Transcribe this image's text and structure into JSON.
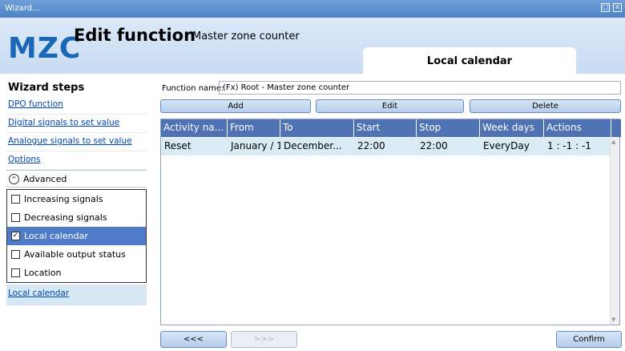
{
  "window": {
    "title": "Wizard...",
    "controls": [
      "□",
      "x"
    ]
  },
  "header": {
    "logo": "MZC",
    "title": "Edit function",
    "subtitle": "Master zone counter",
    "active_tab": "Local calendar"
  },
  "sidebar": {
    "title": "Wizard steps",
    "links": [
      {
        "label": "DPO function"
      },
      {
        "label": "Digital signals to set value"
      },
      {
        "label": "Analogue signals to set value"
      },
      {
        "label": "Options"
      }
    ],
    "advanced": {
      "label": "Advanced",
      "toggle_glyph": "^",
      "items": [
        {
          "label": "Increasing signals",
          "checked": false
        },
        {
          "label": "Decreasing signals",
          "checked": false
        },
        {
          "label": "Local calendar",
          "checked": true,
          "mark": "✓"
        },
        {
          "label": "Available output status",
          "checked": false
        },
        {
          "label": "Location",
          "checked": false
        }
      ]
    },
    "current": "Local calendar"
  },
  "main": {
    "function_name_label": "Function name:",
    "function_name_value": "(Fx) Root - Master zone counter",
    "buttons": {
      "add": "Add",
      "edit": "Edit",
      "delete": "Delete"
    },
    "table": {
      "columns": [
        "Activity na...",
        "From",
        "To",
        "Start",
        "Stop",
        "Week days",
        "Actions"
      ],
      "rows": [
        [
          "Reset",
          "January / 1",
          "December...",
          "22:00",
          "22:00",
          "EveryDay",
          "1 : -1 : -1"
        ]
      ]
    }
  },
  "footer": {
    "back": "<<<",
    "next": ">>>",
    "confirm": "Confirm"
  }
}
